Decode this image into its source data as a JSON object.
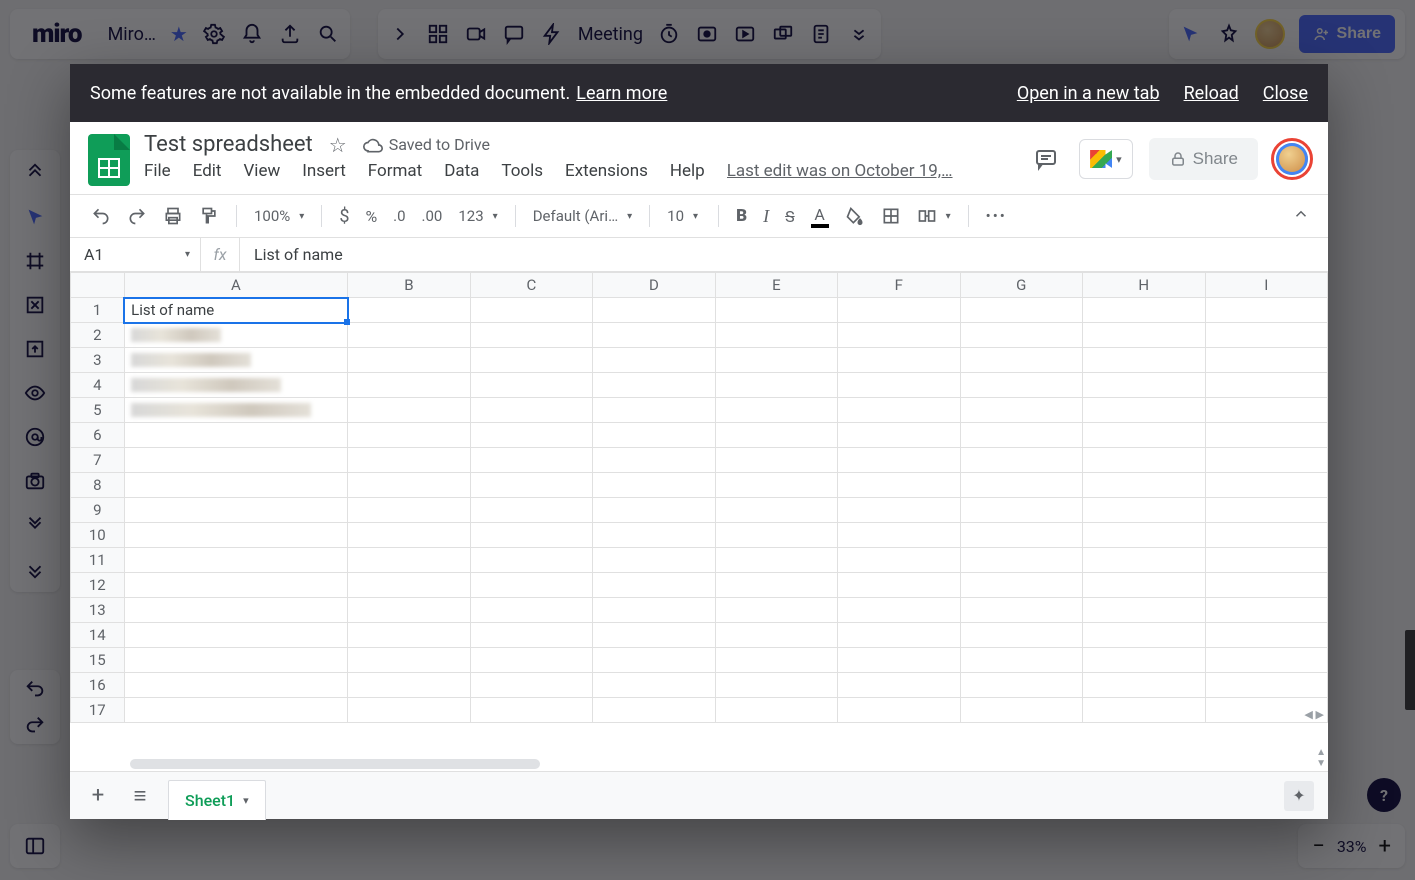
{
  "miro": {
    "board_name": "Miro…",
    "meeting_label": "Meeting",
    "share_label": "Share",
    "zoom": "33%"
  },
  "banner": {
    "msg_prefix": "Some features are not available in the embedded document. ",
    "learn_more": "Learn more",
    "open": "Open in a new tab",
    "reload": "Reload",
    "close": "Close"
  },
  "sheets": {
    "title": "Test spreadsheet",
    "saved": "Saved to Drive",
    "share": "Share",
    "last_edit": "Last edit was on October 19,…",
    "menus": [
      "File",
      "Edit",
      "View",
      "Insert",
      "Format",
      "Data",
      "Tools",
      "Extensions",
      "Help"
    ],
    "zoom": "100%",
    "font": "Default (Ari…",
    "font_size": "10",
    "cell_ref": "A1",
    "fx_value": "List of name",
    "columns": [
      "A",
      "B",
      "C",
      "D",
      "E",
      "F",
      "G",
      "H",
      "I"
    ],
    "rows": [
      1,
      2,
      3,
      4,
      5,
      6,
      7,
      8,
      9,
      10,
      11,
      12,
      13,
      14,
      15,
      16,
      17
    ],
    "a1": "List of name",
    "tab": "Sheet1",
    "fmt_123": "123",
    "fmt_currency": "$",
    "fmt_percent": "%",
    "fmt_dec_dec": ".0",
    "fmt_dec_inc": ".00"
  }
}
